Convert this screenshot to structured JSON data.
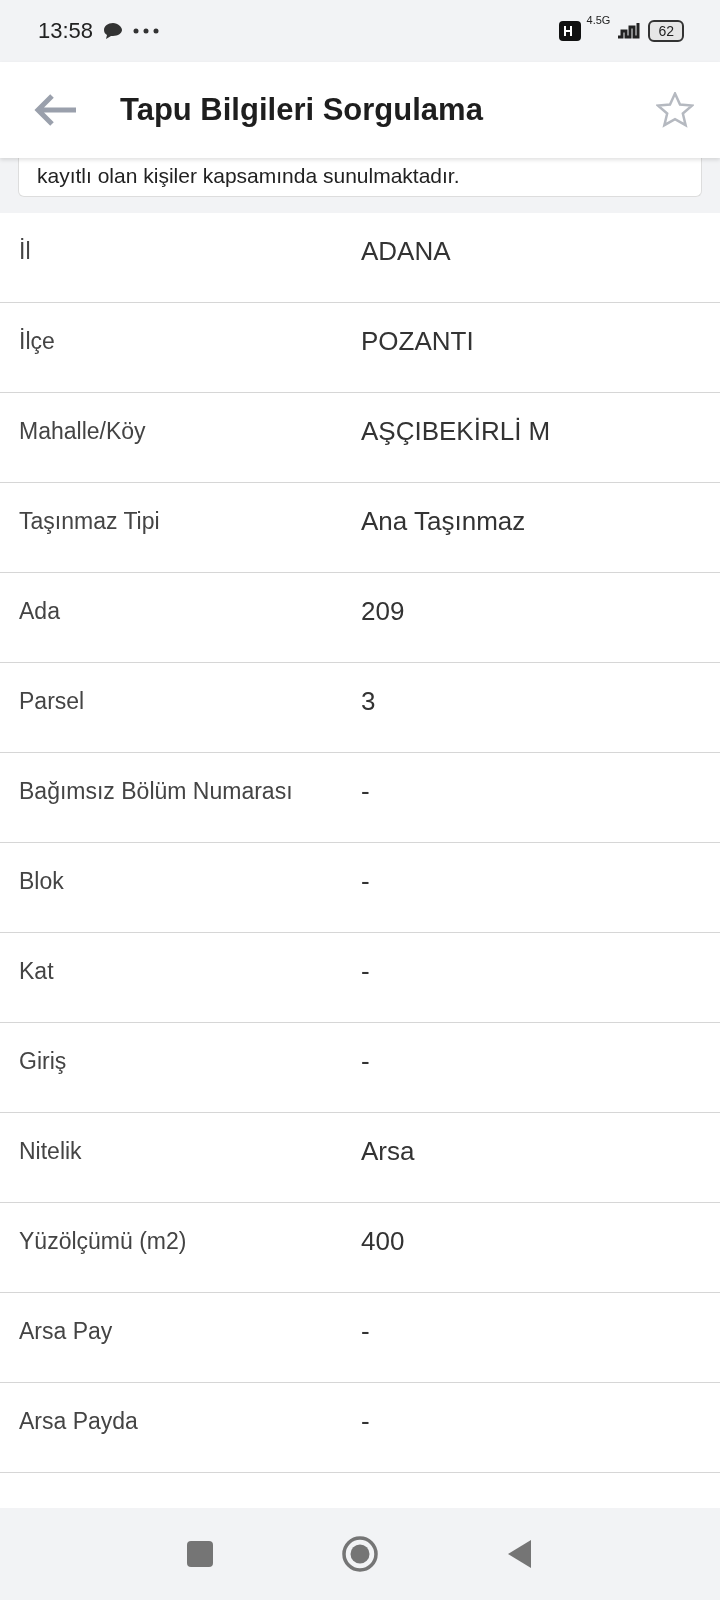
{
  "status_bar": {
    "time": "13:58",
    "network": "4.5G",
    "battery": "62"
  },
  "header": {
    "title": "Tapu Bilgileri Sorgulama",
    "favorite": false
  },
  "notice": "kayıtlı olan kişiler kapsamında sunulmaktadır.",
  "rows": [
    {
      "label": "İl",
      "value": "ADANA"
    },
    {
      "label": "İlçe",
      "value": "POZANTI"
    },
    {
      "label": "Mahalle/Köy",
      "value": "AŞÇIBEKİRLİ M"
    },
    {
      "label": "Taşınmaz Tipi",
      "value": "Ana Taşınmaz"
    },
    {
      "label": "Ada",
      "value": "209"
    },
    {
      "label": "Parsel",
      "value": "3"
    },
    {
      "label": "Bağımsız Bölüm Numarası",
      "value": "-"
    },
    {
      "label": "Blok",
      "value": "-"
    },
    {
      "label": "Kat",
      "value": "-"
    },
    {
      "label": "Giriş",
      "value": "-"
    },
    {
      "label": "Nitelik",
      "value": "Arsa"
    },
    {
      "label": "Yüzölçümü (m2)",
      "value": "400"
    },
    {
      "label": "Arsa Pay",
      "value": "-"
    },
    {
      "label": "Arsa Payda",
      "value": "-"
    }
  ]
}
